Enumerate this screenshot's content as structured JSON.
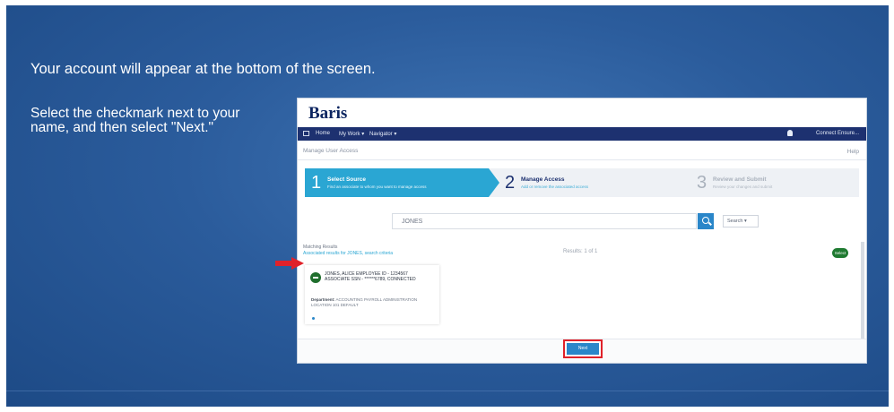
{
  "slide": {
    "headline": "Your account will appear at the bottom of the screen.",
    "instruction": "Select the checkmark next to your name, and then select \"Next.\""
  },
  "app": {
    "logo": "Baris",
    "nav": {
      "items": [
        "Home",
        "My Work ▾",
        "Navigator ▾"
      ],
      "user": "Connect Ensure..."
    },
    "subheader": {
      "title": "Manage User Access",
      "help": "Help"
    },
    "steps": [
      {
        "number": "1",
        "title": "Select Source",
        "subtitle": "Find an associate to whom you want to manage access"
      },
      {
        "number": "2",
        "title": "Manage Access",
        "subtitle": "Add or remove the associated access"
      },
      {
        "number": "3",
        "title": "Review and Submit",
        "subtitle": "Review your changes and submit"
      }
    ],
    "search": {
      "value": "JONES",
      "scope": "Search ▾"
    },
    "results": {
      "meta_line1": "Matching Results",
      "meta_line2": "Associated results for JONES, search criteria",
      "count": "Results: 1 of 1",
      "select_label": "Select"
    },
    "card": {
      "name": "JONES, ALICE  EMPLOYEE ID - 1234567 ASSOCIATE SSN - ******6789, CONNECTED",
      "detail_label": "Department:",
      "detail_text": "ACCOUNTING  PAYROLL  ADMINISTRATION  LOCATION 101  DEFAULT"
    },
    "next_label": "Next"
  }
}
